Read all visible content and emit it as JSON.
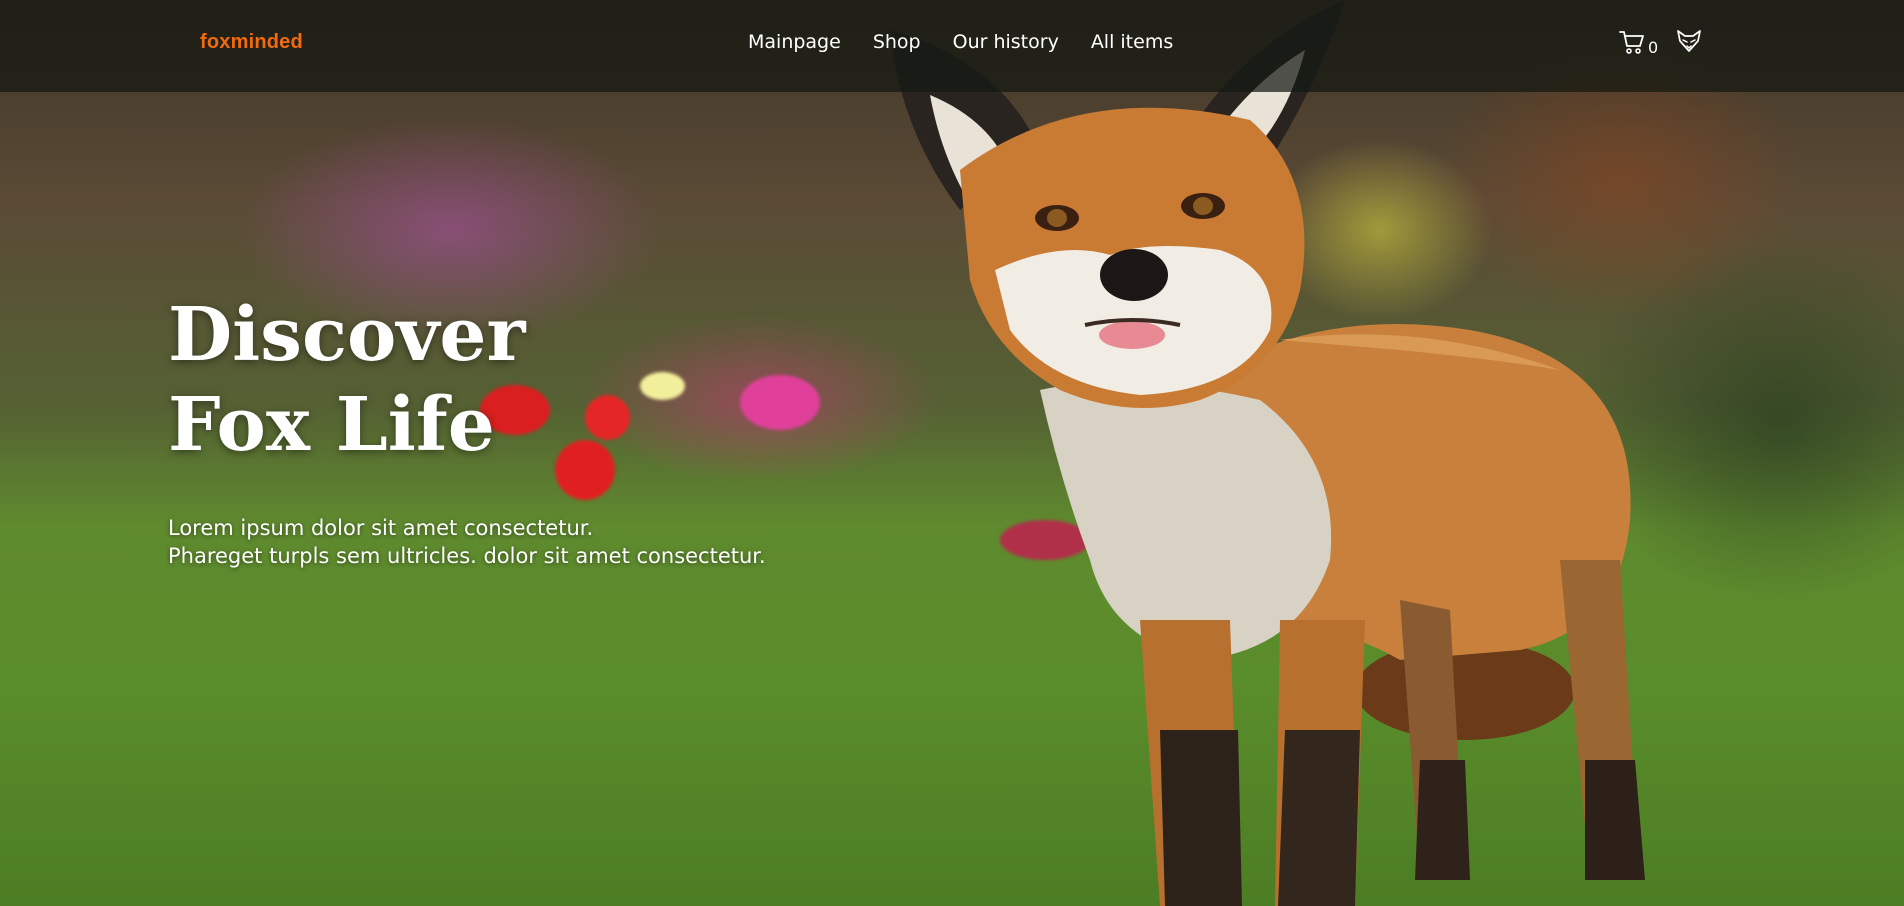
{
  "brand": {
    "name": "foxminded",
    "color": "#f26a0f"
  },
  "nav": {
    "links": [
      {
        "label": "Mainpage"
      },
      {
        "label": "Shop"
      },
      {
        "label": "Our history"
      },
      {
        "label": "All items"
      }
    ],
    "cart": {
      "icon": "cart-icon",
      "count": "0"
    },
    "logo_icon": "fox-head-icon"
  },
  "hero": {
    "title_line1": "Discover",
    "title_line2": "Fox Life",
    "text_line1": "Lorem ipsum dolor sit amet consectetur.",
    "text_line2": "Phareget turpls sem ultricles. dolor sit amet consectetur.",
    "image": "fox-in-garden-photo"
  }
}
